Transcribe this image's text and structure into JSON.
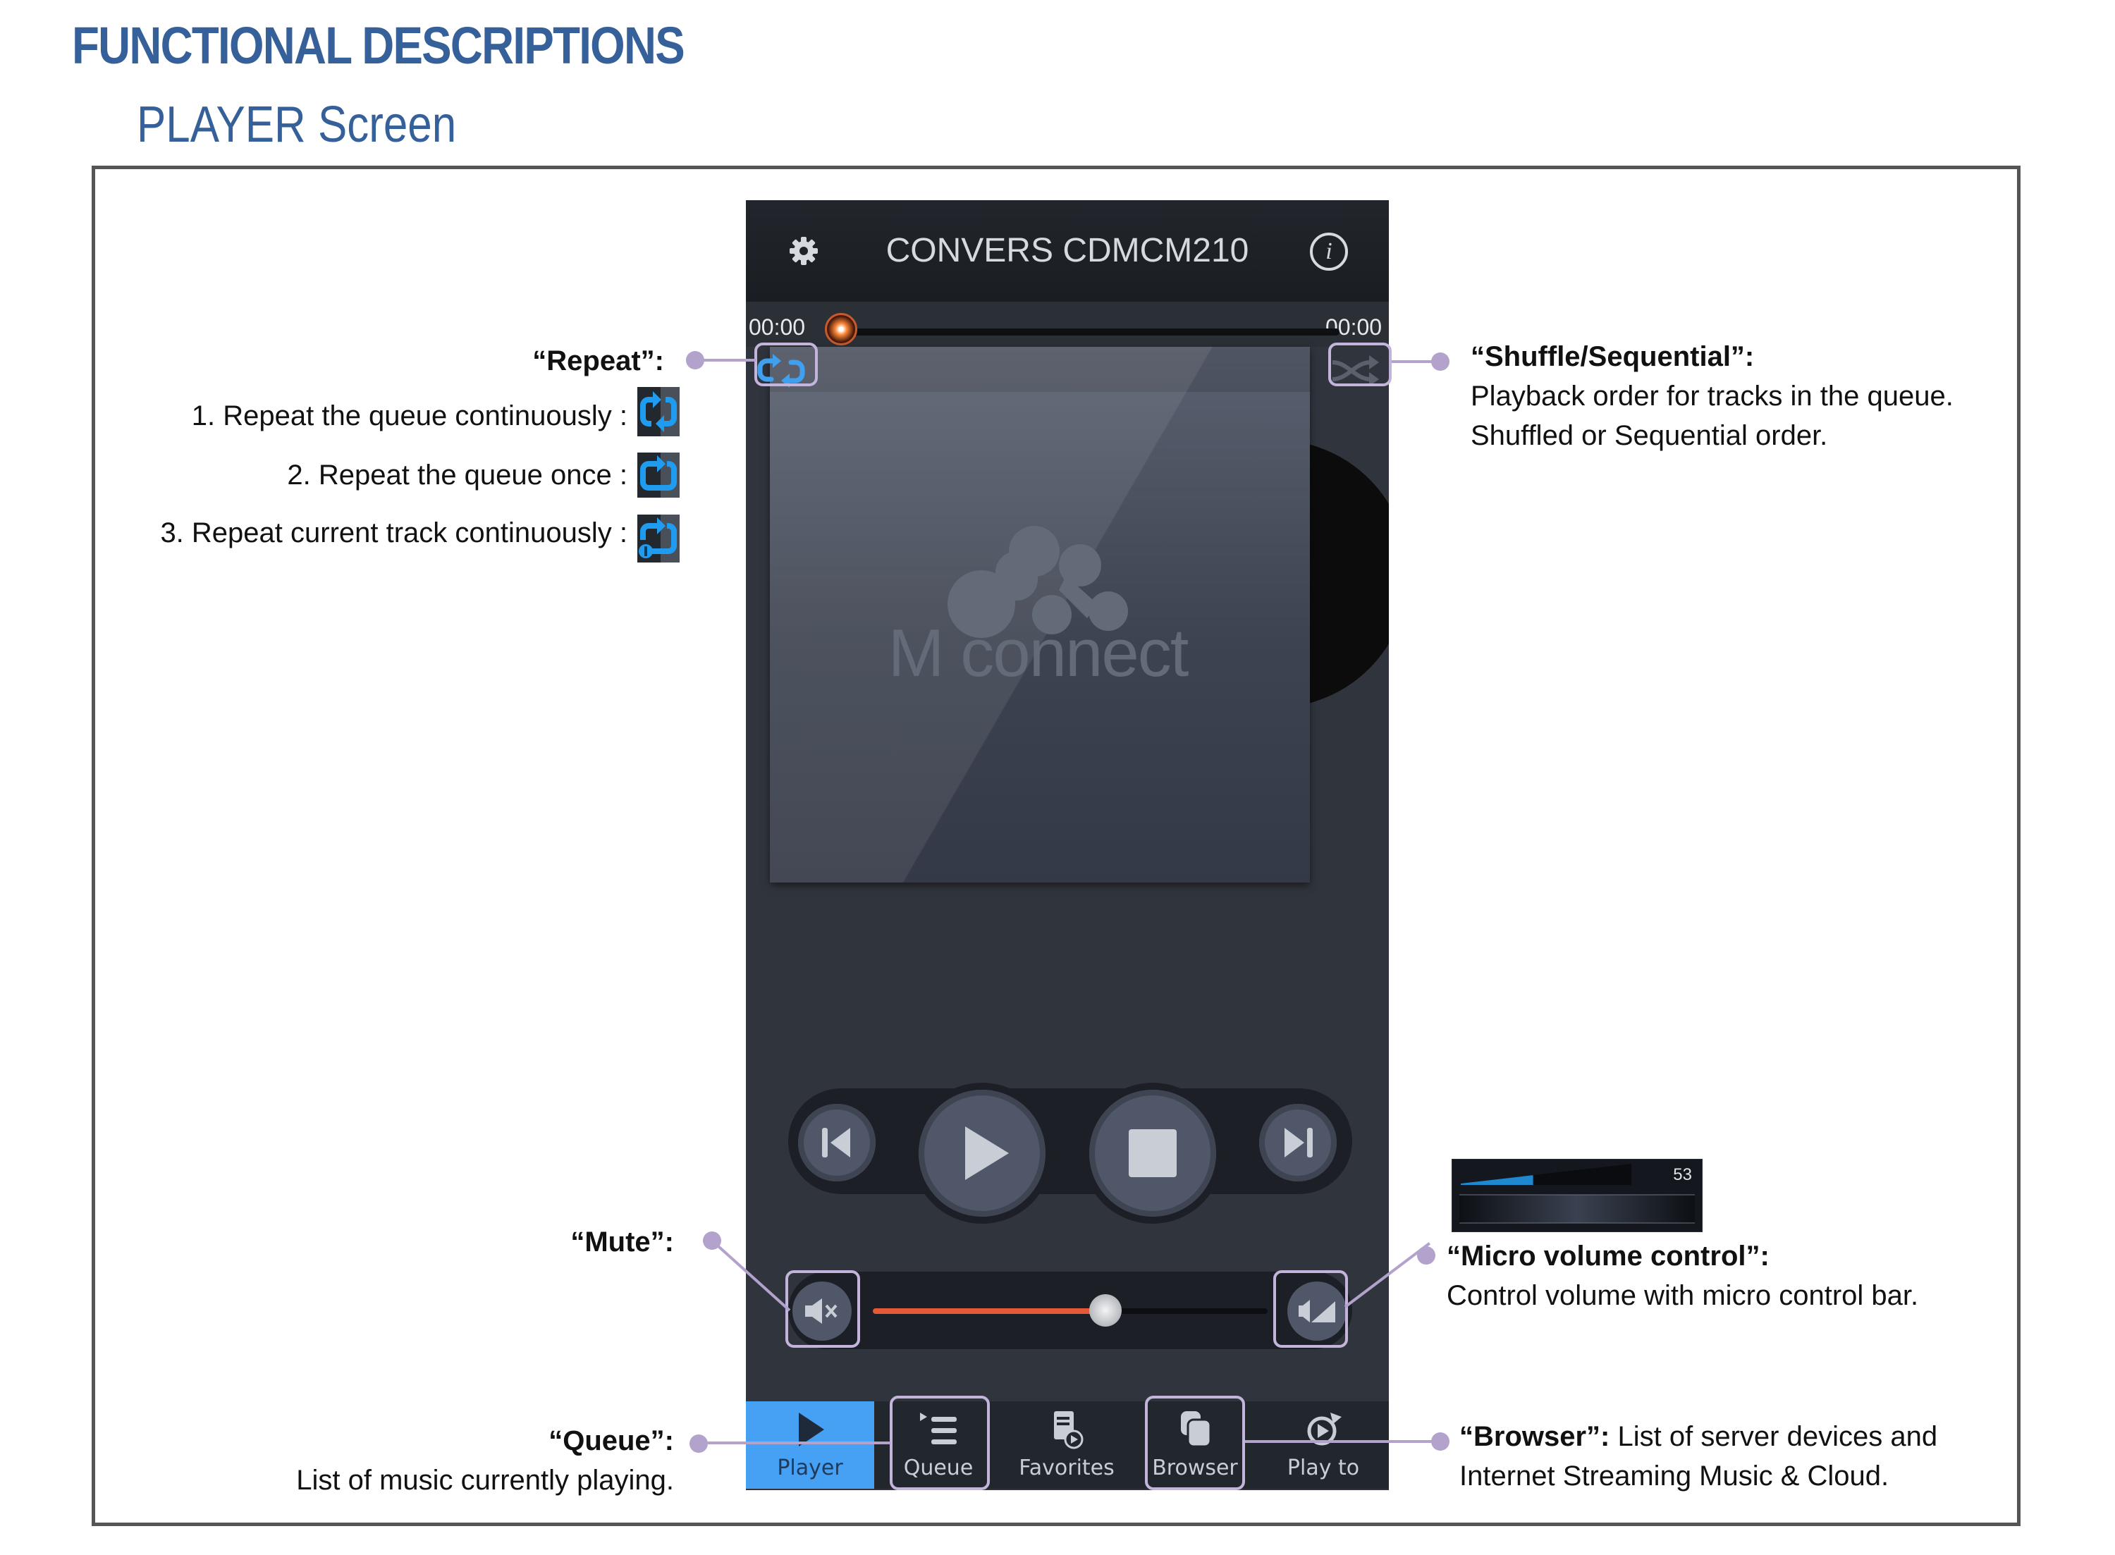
{
  "page": {
    "title": "FUNCTIONAL DESCRIPTIONS",
    "subtitle": "PLAYER Screen"
  },
  "colors": {
    "heading": "#36609a",
    "callout": "#b2a2cc",
    "accent_blue": "#46a0f3",
    "volume_fill": "#e55a36",
    "phone_bg": "#30353d"
  },
  "phone": {
    "header": {
      "settings_icon": "gear-icon",
      "device_name": "CONVERS CDMCM210",
      "info_icon": "info-icon",
      "info_glyph": "i"
    },
    "progress": {
      "elapsed": "00:00",
      "total": "00:00",
      "position_fraction": 0.0
    },
    "repeat_icon": "repeat-icon",
    "shuffle_icon": "shuffle-icon",
    "album_art": {
      "logo_text": "M connect"
    },
    "transport": {
      "previous": "previous-icon",
      "play": "play-icon",
      "stop": "stop-icon",
      "next": "next-icon"
    },
    "volume": {
      "mute_icon": "mute-icon",
      "micro_volume_icon": "micro-volume-icon",
      "level_fraction": 0.59
    },
    "tabs": [
      {
        "label": "Player",
        "icon": "play-icon",
        "active": true
      },
      {
        "label": "Queue",
        "icon": "queue-icon",
        "active": false
      },
      {
        "label": "Favorites",
        "icon": "favorites-icon",
        "active": false
      },
      {
        "label": "Browser",
        "icon": "browser-icon",
        "active": false
      },
      {
        "label": "Play to",
        "icon": "play-to-icon",
        "active": false
      }
    ]
  },
  "annotations": {
    "repeat": {
      "title": "“Repeat”:",
      "modes": [
        {
          "label": "1. Repeat the queue continuously :",
          "icon": "repeat-all-icon"
        },
        {
          "label": "2. Repeat the queue once :",
          "icon": "repeat-once-icon"
        },
        {
          "label": "3. Repeat current track continuously :",
          "icon": "repeat-one-icon"
        }
      ]
    },
    "shuffle": {
      "title": "“Shuffle/Sequential”:",
      "line1": "Playback order for tracks in the queue.",
      "line2": "Shuffled or Sequential order."
    },
    "mute": {
      "title": "“Mute”:"
    },
    "micro_volume": {
      "title": "“Micro volume control”:",
      "description": "Control volume with micro control bar.",
      "panel_value": "53",
      "panel_level_fraction": 0.53
    },
    "queue": {
      "title": "“Queue”:",
      "description": "List of music currently playing."
    },
    "browser": {
      "title": "“Browser”:",
      "line1": " List of server devices and",
      "line2": "Internet Streaming Music & Cloud."
    }
  }
}
